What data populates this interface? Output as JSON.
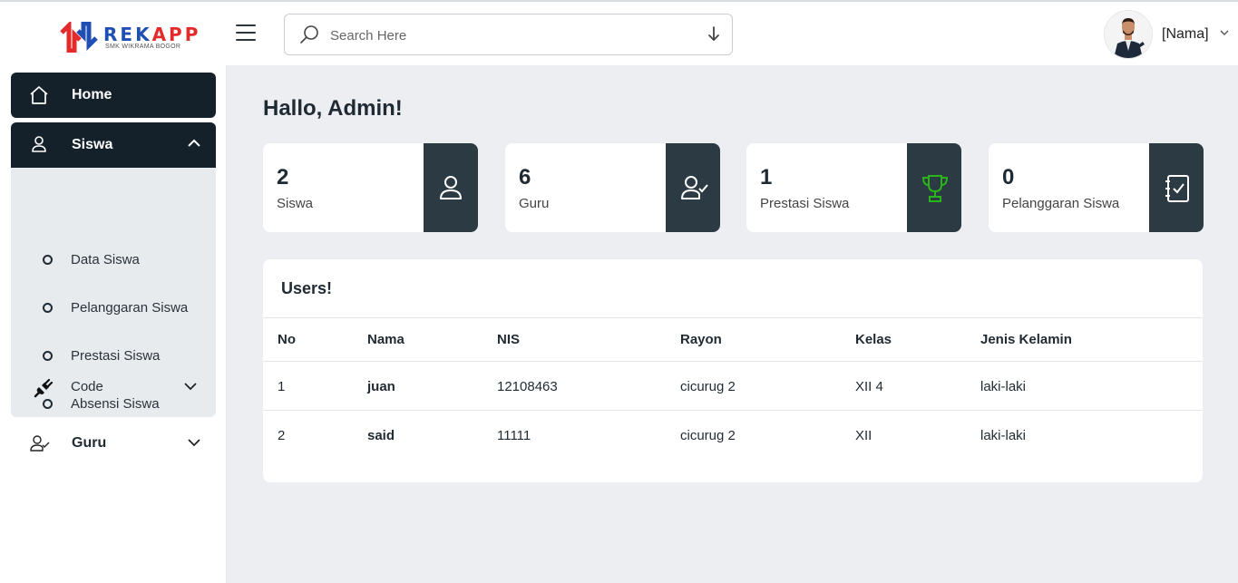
{
  "brand": {
    "name_part1": "REK",
    "name_part2": "APP",
    "subtitle": "SMK WIKRAMA BOGOR"
  },
  "header": {
    "search_placeholder": "Search Here",
    "user_name": "[Nama]"
  },
  "sidebar": {
    "home": "Home",
    "siswa": "Siswa",
    "siswa_items": [
      "Data Siswa",
      "Pelanggaran Siswa",
      "Prestasi Siswa",
      "Absensi Siswa",
      "Code"
    ],
    "guru": "Guru"
  },
  "main": {
    "title": "Hallo, Admin!",
    "cards": [
      {
        "value": "2",
        "label": "Siswa",
        "icon": "user-icon"
      },
      {
        "value": "6",
        "label": "Guru",
        "icon": "user-check-icon"
      },
      {
        "value": "1",
        "label": "Prestasi Siswa",
        "icon": "trophy-icon"
      },
      {
        "value": "0",
        "label": "Pelanggaran Siswa",
        "icon": "notebook-check-icon"
      }
    ],
    "table": {
      "title": "Users!",
      "columns": [
        "No",
        "Nama",
        "NIS",
        "Rayon",
        "Kelas",
        "Jenis Kelamin"
      ],
      "rows": [
        [
          "1",
          "juan",
          "12108463",
          "cicurug 2",
          "XII 4",
          "laki-laki"
        ],
        [
          "2",
          "said",
          "11111",
          "cicurug 2",
          "XII",
          "laki-laki"
        ]
      ]
    }
  },
  "colors": {
    "sidebar_active": "#14212b",
    "card_side": "#2c3a43",
    "trophy": "#2bb31a",
    "brand_blue": "#1f4fb3",
    "brand_red": "#e32b2b"
  }
}
